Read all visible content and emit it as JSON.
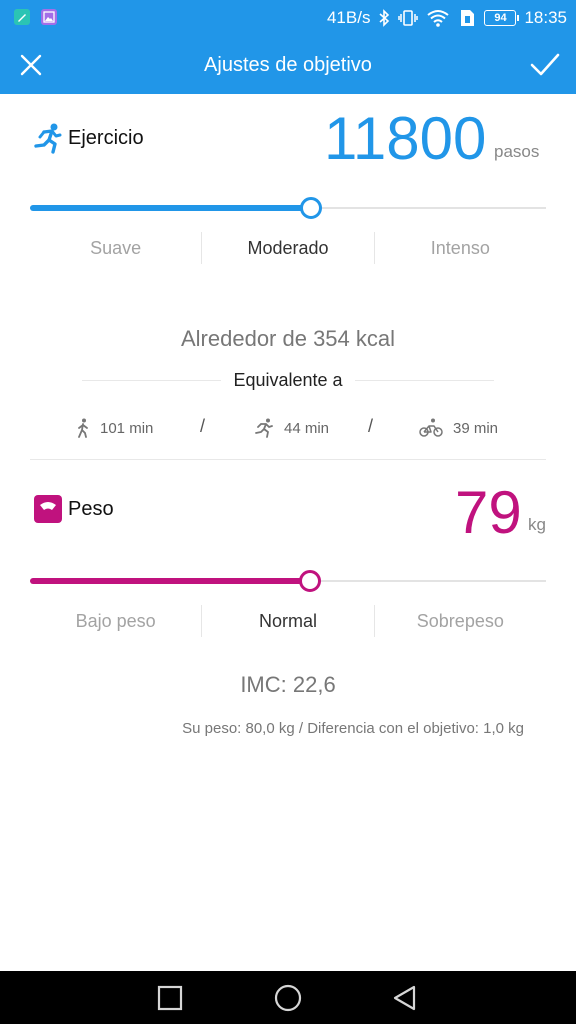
{
  "status_bar": {
    "speed": "41B/s",
    "battery": "94",
    "time": "18:35",
    "icons": [
      "notes-app-icon",
      "gallery-app-icon",
      "bluetooth-icon",
      "vibrate-icon",
      "wifi-icon",
      "sim-icon",
      "battery-icon"
    ]
  },
  "header": {
    "title": "Ajustes de objetivo",
    "close_icon": "close-icon",
    "confirm_icon": "check-icon"
  },
  "exercise": {
    "label": "Ejercicio",
    "icon": "running-icon",
    "value": "11800",
    "unit": "pasos",
    "slider_fraction": 0.545,
    "accent": "#2196e8",
    "levels": [
      "Suave",
      "Moderado",
      "Intenso"
    ],
    "active_level": "Moderado",
    "kcal_text": "Alrededor de 354 kcal",
    "equivalent_label": "Equivalente a",
    "activities": [
      {
        "icon": "walking-icon",
        "text": "101 min"
      },
      {
        "icon": "running-icon",
        "text": "44 min"
      },
      {
        "icon": "cycling-icon",
        "text": "39 min"
      }
    ],
    "separator": "/"
  },
  "weight": {
    "label": "Peso",
    "icon": "scale-icon",
    "value": "79",
    "unit": "kg",
    "slider_fraction": 0.543,
    "accent": "#c0127e",
    "levels": [
      "Bajo peso",
      "Normal",
      "Sobrepeso"
    ],
    "active_level": "Normal",
    "imc": "IMC: 22,6",
    "info": "Su peso: 80,0 kg / Diferencia con el objetivo: 1,0 kg"
  },
  "nav_bar": {
    "icons": [
      "recents-icon",
      "home-icon",
      "back-icon"
    ]
  }
}
